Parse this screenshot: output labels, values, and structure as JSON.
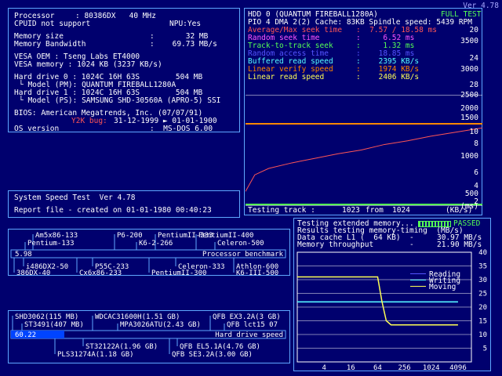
{
  "version": "Ver 4.78",
  "sysinfo": {
    "processor_label": "Processor",
    "processor_value": ": 80386DX   40 MHz",
    "cpuid": "CPUID not support",
    "npu": "NPU:Yes",
    "mem_size_label": "Memory size",
    "mem_size_value": ":       32 MB",
    "mem_bw_label": "Memory Bandwidth",
    "mem_bw_value": ":    69.73 MB/s",
    "vesa_oem": "VESA OEM : Tseng Labs ET4000",
    "vesa_mem": "VESA memory : 1024 KB (3237 KB/s)",
    "hd0": "Hard drive 0 : 1024C 16H 63S        504 MB",
    "hd0_model": "└ Model (PM): QUANTUM FIREBALL1280A",
    "hd1": "Hard drive 1 : 1024C 16H 63S        504 MB",
    "hd1_model": "└ Model (PS): SAMSUNG SHD-30560A (APRO-5) SSI",
    "bios": "BIOS: American Megatrends, Inc. (07/07/91)",
    "y2k_label": "Y2K bug:",
    "y2k_value": "31-12-1999 ► 01-01-1900",
    "os_label": "OS version",
    "os_value": ":  MS-DOS 6.00"
  },
  "speedtest": {
    "title": "System Speed Test  Ver 4.78",
    "report": "Report file - created on 01-01-1980 00:40:23"
  },
  "hdd": {
    "title": "HDD 0 (QUANTUM FIREBALL1280A)",
    "full_test": "FULL TEST",
    "pio": "PIO 4 DMA 2(2) Cache: 83KB Spindle speed: 5439 RPM",
    "metrics": [
      {
        "label": "Average/Max seek time",
        "value": ":  7.57 / 18.58 ms",
        "color": "#ff5555"
      },
      {
        "label": "Random seek time",
        "value": ":     6.52 ms",
        "color": "#ff55ff"
      },
      {
        "label": "Track-to-track seek",
        "value": ":     1.32 ms",
        "color": "#55ff55"
      },
      {
        "label": "Random access time",
        "value": ":    18.85 ms",
        "color": "#5555ff"
      },
      {
        "label": "Buffered read speed",
        "value": ":    2395 KB/s",
        "color": "#55ffff"
      },
      {
        "label": "Linear verify speed",
        "value": ":    1974 KB/s",
        "color": "#ff8800"
      },
      {
        "label": "Linear read speed",
        "value": ":    2406 KB/s",
        "color": "#ffff55"
      }
    ],
    "right_ticks": [
      "20",
      "3500",
      "24",
      "3000",
      "28",
      "2500",
      "2000",
      "1500",
      "10",
      "8",
      "1000",
      "6",
      "4",
      "500",
      "2",
      "(ms)"
    ],
    "testing_label": "Testing track :",
    "testing_track": "1023",
    "testing_from": "from",
    "testing_total": "1024",
    "kbs": "(KB/s)"
  },
  "memtest": {
    "line1": "Testing extended memory...",
    "passed": "PASSED",
    "line2": "Results testing memory-timing  (MB/s)",
    "cache_label": "Data cache L1 (  64 KB)  -",
    "cache_value": "30.97 MB/s",
    "mem_label": "Memory throughput        -",
    "mem_value": "21.90 MB/s",
    "legend": [
      "Reading",
      "Writing",
      "Moving"
    ],
    "legend_colors": [
      "#5555ff",
      "#55ffff",
      "#ffff55"
    ],
    "y_ticks": [
      "40",
      "35",
      "30",
      "25",
      "20",
      "15",
      "10",
      "5"
    ],
    "x_ticks": [
      "4",
      "16",
      "64",
      "256",
      "1024",
      "4096"
    ]
  },
  "chart_data": [
    {
      "type": "line",
      "title": "HDD 0 (QUANTUM FIREBALL1280A)",
      "xlabel": "Testing track",
      "series": [
        {
          "name": "Linear verify speed",
          "x": [
            0,
            1023
          ],
          "values": [
            1974,
            1974
          ]
        },
        {
          "name": "Average/Max seek time",
          "x": [
            0,
            40,
            100,
            200,
            300,
            400,
            500,
            600,
            700,
            800,
            900,
            1023
          ],
          "values": [
            1.5,
            3.3,
            4.0,
            4.6,
            5.1,
            5.6,
            6.0,
            6.6,
            7.0,
            7.5,
            7.9,
            8.4
          ]
        }
      ]
    },
    {
      "type": "line",
      "title": "Results testing memory-timing",
      "xlabel": "KB",
      "ylabel": "(MB/s)",
      "categories": [
        "4",
        "16",
        "64",
        "256",
        "1024",
        "4096"
      ],
      "ylim": [
        0,
        40
      ],
      "series": [
        {
          "name": "Reading",
          "x": [
            1,
            4,
            16,
            32,
            64,
            90,
            128,
            256,
            1024,
            4096
          ],
          "values": [
            21.9,
            21.9,
            21.9,
            21.9,
            21.9,
            21.9,
            21.9,
            21.9,
            21.9,
            21.9
          ]
        },
        {
          "name": "Writing",
          "x": [
            1,
            4,
            16,
            32,
            64,
            90,
            128,
            256,
            1024,
            4096
          ],
          "values": [
            21.9,
            21.9,
            21.9,
            21.9,
            21.9,
            21.9,
            21.9,
            21.9,
            21.9,
            21.9
          ]
        },
        {
          "name": "Moving",
          "x": [
            1,
            4,
            16,
            32,
            64,
            80,
            100,
            128,
            256,
            1024,
            4096
          ],
          "values": [
            31,
            31,
            31,
            31,
            31,
            22,
            15,
            13.5,
            13.5,
            13.5,
            13.5
          ]
        }
      ]
    }
  ],
  "cpu_bench": {
    "top_row1": [
      "Am5x86-133",
      "P6-200",
      "PentiumII-233",
      "PentiumII-400"
    ],
    "top_row2": [
      "Pentium-133",
      "K6-2-266",
      "Celeron-500"
    ],
    "value": "5.98",
    "label": "Processor benchmark",
    "bottom_row1": [
      "i486DX2-50",
      "P55C-233",
      "Celeron-333",
      "Athlon-600"
    ],
    "bottom_row2": [
      "386DX-40",
      "Cx6x86-233",
      "PentiumII-300",
      "K6-III-500"
    ]
  },
  "hdd_bench": {
    "top_row1": [
      "SHD3062(115 MB)",
      "WDCAC31600H(1.51 GB)",
      "QFB EX3.2A(3 GB)"
    ],
    "top_row2": [
      "ST3491(407 MB)",
      "MPA3026ATU(2.43 GB)",
      "QFB lct15 07"
    ],
    "value": "60.22",
    "label": "Hard drive speed",
    "bottom_row1": [
      "ST32122A(1.96 GB)",
      "QFB EL5.1A(4.76 GB)"
    ],
    "bottom_row2": [
      "PLS31274A(1.18 GB)",
      "QFB SE3.2A(3.00 GB)"
    ]
  }
}
